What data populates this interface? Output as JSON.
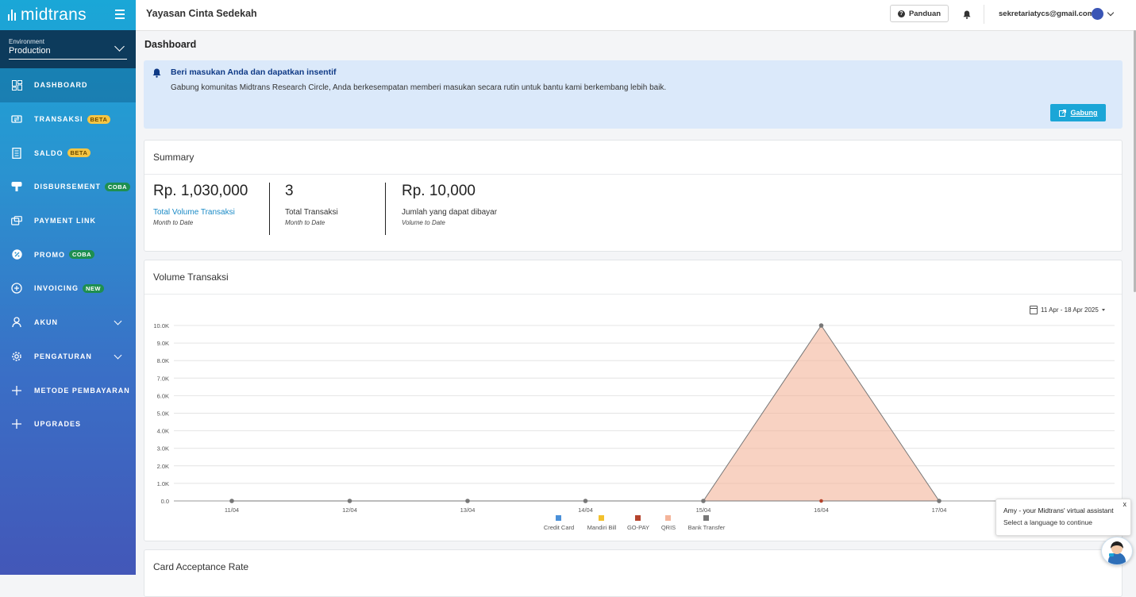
{
  "brand": {
    "name": "midtrans"
  },
  "environment": {
    "label": "Environment",
    "value": "Production"
  },
  "sidebar": {
    "items": [
      {
        "label": "DASHBOARD",
        "icon": "dashboard-icon",
        "active": true,
        "badge": ""
      },
      {
        "label": "TRANSAKSI",
        "icon": "transaction-icon",
        "badge": "BETA"
      },
      {
        "label": "SALDO",
        "icon": "balance-icon",
        "badge": "BETA"
      },
      {
        "label": "DISBURSEMENT",
        "icon": "disbursement-icon",
        "badge": "COBA"
      },
      {
        "label": "PAYMENT LINK",
        "icon": "payment-link-icon",
        "badge": ""
      },
      {
        "label": "PROMO",
        "icon": "promo-icon",
        "badge": "COBA"
      },
      {
        "label": "INVOICING",
        "icon": "invoicing-icon",
        "badge": "NEW"
      },
      {
        "label": "AKUN",
        "icon": "user-icon",
        "badge": "",
        "expandable": true
      },
      {
        "label": "PENGATURAN",
        "icon": "gear-icon",
        "badge": "",
        "expandable": true
      },
      {
        "label": "METODE PEMBAYARAN",
        "icon": "plus-icon",
        "badge": ""
      },
      {
        "label": "UPGRADES",
        "icon": "plus-icon",
        "badge": ""
      }
    ]
  },
  "header": {
    "org_name": "Yayasan Cinta Sedekah",
    "help_label": "Panduan",
    "email": "sekretariatycs@gmail.com"
  },
  "page": {
    "title": "Dashboard"
  },
  "banner": {
    "title": "Beri masukan Anda dan dapatkan insentif",
    "text": "Gabung komunitas Midtrans Research Circle, Anda berkesempatan memberi masukan secara rutin untuk bantu kami berkembang lebih baik.",
    "button_label": "Gabung"
  },
  "summary": {
    "title": "Summary",
    "metrics": [
      {
        "value": "Rp. 1,030,000",
        "label": "Total Volume Transaksi",
        "sub": "Month to Date"
      },
      {
        "value": "3",
        "label": "Total Transaksi",
        "sub": "Month to Date"
      },
      {
        "value": "Rp. 10,000",
        "label": "Jumlah yang dapat dibayar",
        "sub": "Volume to Date"
      }
    ]
  },
  "volume": {
    "title": "Volume Transaksi",
    "date_range": "11 Apr - 18 Apr 2025"
  },
  "chart_data": {
    "type": "area",
    "x": [
      "11/04",
      "12/04",
      "13/04",
      "14/04",
      "15/04",
      "16/04",
      "17/04"
    ],
    "series": [
      {
        "name": "Credit Card",
        "color": "#4a90d9",
        "values": [
          0,
          0,
          0,
          0,
          0,
          0,
          0
        ]
      },
      {
        "name": "Mandiri Bill",
        "color": "#f2c12e",
        "values": [
          0,
          0,
          0,
          0,
          0,
          0,
          0
        ]
      },
      {
        "name": "GO-PAY",
        "color": "#b5442d",
        "values": [
          0,
          0,
          0,
          0,
          0,
          0,
          0
        ]
      },
      {
        "name": "QRIS",
        "color": "#f4b49a",
        "values": [
          0,
          0,
          0,
          0,
          0,
          10000,
          0
        ]
      },
      {
        "name": "Bank Transfer",
        "color": "#777777",
        "values": [
          0,
          0,
          0,
          0,
          0,
          0,
          0
        ]
      }
    ],
    "yticks": [
      "0.0",
      "1.0K",
      "2.0K",
      "3.0K",
      "4.0K",
      "5.0K",
      "6.0K",
      "7.0K",
      "8.0K",
      "9.0K",
      "10.0K"
    ],
    "ylim": [
      0,
      10000
    ],
    "grid": true,
    "legend": "bottom"
  },
  "card_acceptance": {
    "title": "Card Acceptance Rate"
  },
  "assistant": {
    "title": "Amy - your Midtrans' virtual assistant",
    "text": "Select a language to continue",
    "close": "x"
  }
}
